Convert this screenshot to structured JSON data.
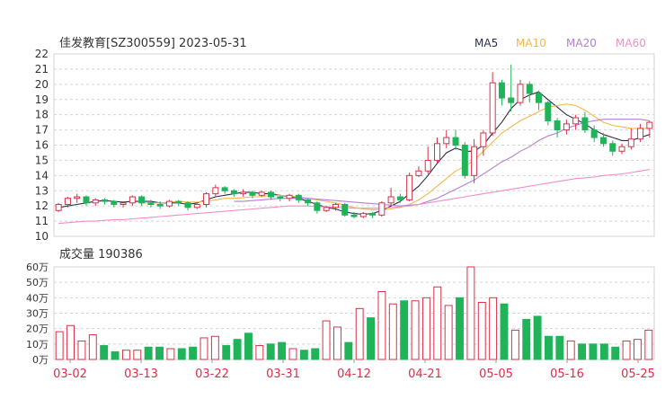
{
  "title": "佳发教育[SZ300559] 2023-05-31",
  "legend": [
    {
      "label": "MA5",
      "color": "#2b2d4f"
    },
    {
      "label": "MA10",
      "color": "#f2b84b"
    },
    {
      "label": "MA20",
      "color": "#b07fd6"
    },
    {
      "label": "MA60",
      "color": "#f08fc5"
    }
  ],
  "volume_label": "成交量 190386",
  "colors": {
    "up": "#d9304a",
    "down": "#21b35a",
    "grid": "#d4d4d4",
    "axis_text": "#333333",
    "date_text": "#d9304a"
  },
  "chart_data": [
    {
      "type": "candlestick",
      "title": "佳发教育[SZ300559] 2023-05-31",
      "ylim": [
        10,
        22
      ],
      "yticks": [
        10,
        11,
        12,
        13,
        14,
        15,
        16,
        17,
        18,
        19,
        20,
        21,
        22
      ],
      "dates": [
        "03-02",
        "03-13",
        "03-22",
        "03-31",
        "04-12",
        "04-21",
        "05-05",
        "05-16",
        "05-25"
      ],
      "candles": [
        [
          11.7,
          12.1,
          11.6,
          12.2
        ],
        [
          12.1,
          12.5,
          11.9,
          12.6
        ],
        [
          12.5,
          12.6,
          12.2,
          12.8
        ],
        [
          12.6,
          12.2,
          12.0,
          12.7
        ],
        [
          12.2,
          12.4,
          12.0,
          12.5
        ],
        [
          12.4,
          12.3,
          12.1,
          12.5
        ],
        [
          12.3,
          12.1,
          11.9,
          12.4
        ],
        [
          12.1,
          12.2,
          11.9,
          12.3
        ],
        [
          12.2,
          12.6,
          12.0,
          12.7
        ],
        [
          12.6,
          12.2,
          12.0,
          12.7
        ],
        [
          12.2,
          12.1,
          11.9,
          12.4
        ],
        [
          12.1,
          12.0,
          11.8,
          12.3
        ],
        [
          12.0,
          12.3,
          11.9,
          12.4
        ],
        [
          12.3,
          12.2,
          12.0,
          12.4
        ],
        [
          12.2,
          11.9,
          11.7,
          12.3
        ],
        [
          11.9,
          12.1,
          11.8,
          12.2
        ],
        [
          12.1,
          12.8,
          11.9,
          12.9
        ],
        [
          12.8,
          13.2,
          12.6,
          13.4
        ],
        [
          13.2,
          13.0,
          12.8,
          13.3
        ],
        [
          13.0,
          12.8,
          12.6,
          13.1
        ],
        [
          12.8,
          12.9,
          12.6,
          13.1
        ],
        [
          12.9,
          12.7,
          12.5,
          13.0
        ],
        [
          12.7,
          12.9,
          12.6,
          13.0
        ],
        [
          12.9,
          12.6,
          12.4,
          13.0
        ],
        [
          12.6,
          12.5,
          12.3,
          12.7
        ],
        [
          12.5,
          12.7,
          12.3,
          12.8
        ],
        [
          12.7,
          12.4,
          12.2,
          12.8
        ],
        [
          12.4,
          12.2,
          12.0,
          12.5
        ],
        [
          12.2,
          11.7,
          11.5,
          12.3
        ],
        [
          11.7,
          11.9,
          11.6,
          12.0
        ],
        [
          11.9,
          12.1,
          11.7,
          12.2
        ],
        [
          12.1,
          11.4,
          11.3,
          12.2
        ],
        [
          11.4,
          11.3,
          11.2,
          11.6
        ],
        [
          11.3,
          11.5,
          11.2,
          11.6
        ],
        [
          11.5,
          11.4,
          11.2,
          11.6
        ],
        [
          11.4,
          12.2,
          11.3,
          12.3
        ],
        [
          12.2,
          12.6,
          12.0,
          13.2
        ],
        [
          12.6,
          12.4,
          12.2,
          12.8
        ],
        [
          12.4,
          14.0,
          12.3,
          14.2
        ],
        [
          14.0,
          14.3,
          13.9,
          14.6
        ],
        [
          14.3,
          15.0,
          14.1,
          15.9
        ],
        [
          15.0,
          16.1,
          14.8,
          16.5
        ],
        [
          16.1,
          16.5,
          15.8,
          17.0
        ],
        [
          16.5,
          16.0,
          15.7,
          17.0
        ],
        [
          16.0,
          14.0,
          13.8,
          16.2
        ],
        [
          14.0,
          15.9,
          13.5,
          16.4
        ],
        [
          15.9,
          16.8,
          15.3,
          17.0
        ],
        [
          16.8,
          20.1,
          16.6,
          20.8
        ],
        [
          20.1,
          19.1,
          18.6,
          20.3
        ],
        [
          19.1,
          18.8,
          18.2,
          21.3
        ],
        [
          18.8,
          20.0,
          18.6,
          20.3
        ],
        [
          20.0,
          19.4,
          18.8,
          20.2
        ],
        [
          19.4,
          18.8,
          18.3,
          19.6
        ],
        [
          18.8,
          17.6,
          17.3,
          18.9
        ],
        [
          17.6,
          17.0,
          16.5,
          17.8
        ],
        [
          17.0,
          17.4,
          16.7,
          17.7
        ],
        [
          17.4,
          17.8,
          17.0,
          18.0
        ],
        [
          17.8,
          17.0,
          16.8,
          18.2
        ],
        [
          17.0,
          16.5,
          16.2,
          17.3
        ],
        [
          16.5,
          16.1,
          15.9,
          16.8
        ],
        [
          16.1,
          15.6,
          15.3,
          16.3
        ],
        [
          15.6,
          15.9,
          15.4,
          16.1
        ],
        [
          15.9,
          16.4,
          15.7,
          17.1
        ],
        [
          16.4,
          17.1,
          16.2,
          17.4
        ],
        [
          17.1,
          17.5,
          16.5,
          17.6
        ]
      ],
      "volumes": [
        18,
        22,
        12,
        16,
        9,
        5,
        6,
        6,
        8,
        8,
        7,
        7,
        8,
        14,
        15,
        9,
        13,
        17,
        9,
        10,
        11,
        7,
        6,
        7,
        25,
        21,
        11,
        33,
        27,
        44,
        36,
        38,
        38,
        40,
        47,
        35,
        40,
        60,
        37,
        40,
        36,
        19,
        26,
        28,
        15,
        15,
        12,
        10,
        10,
        10,
        8,
        12,
        13,
        19
      ],
      "vol_ylim": [
        0,
        60
      ],
      "vol_ticks": [
        "0万",
        "10万",
        "20万",
        "30万",
        "40万",
        "50万",
        "60万"
      ],
      "ma_lines": [
        {
          "name": "MA5",
          "values": [
            11.9,
            12.0,
            12.1,
            12.2,
            12.3,
            12.35,
            12.3,
            12.25,
            12.3,
            12.3,
            12.3,
            12.2,
            12.2,
            12.2,
            12.1,
            12.2,
            12.4,
            12.6,
            12.7,
            12.8,
            12.9,
            12.9,
            12.8,
            12.8,
            12.7,
            12.6,
            12.5,
            12.3,
            12.1,
            11.9,
            11.8,
            11.6,
            11.5,
            11.45,
            11.5,
            11.7,
            12.0,
            12.3,
            12.8,
            13.3,
            14.0,
            14.8,
            15.5,
            15.8,
            15.6,
            15.6,
            16.0,
            16.8,
            17.5,
            18.4,
            19.0,
            19.3,
            19.5,
            19.0,
            18.5,
            18.0,
            17.7,
            17.4,
            17.0,
            16.7,
            16.5,
            16.3,
            16.3,
            16.5,
            16.7
          ]
        },
        {
          "name": "MA10",
          "values": [
            null,
            null,
            null,
            null,
            null,
            null,
            null,
            null,
            null,
            12.2,
            12.2,
            12.2,
            12.25,
            12.3,
            12.25,
            12.25,
            12.3,
            12.4,
            12.5,
            12.5,
            12.55,
            12.6,
            12.6,
            12.7,
            12.7,
            12.65,
            12.6,
            12.5,
            12.4,
            12.3,
            12.2,
            12.05,
            11.9,
            11.8,
            11.75,
            11.75,
            11.8,
            11.9,
            12.1,
            12.4,
            12.8,
            13.3,
            13.8,
            14.3,
            14.6,
            15.0,
            15.6,
            16.2,
            16.8,
            17.2,
            17.6,
            17.9,
            18.2,
            18.5,
            18.6,
            18.7,
            18.6,
            18.3,
            17.9,
            17.5,
            17.3,
            17.2,
            17.1,
            17.1,
            17.1
          ]
        },
        {
          "name": "MA20",
          "values": [
            null,
            null,
            null,
            null,
            null,
            null,
            null,
            null,
            null,
            null,
            null,
            null,
            null,
            null,
            null,
            null,
            null,
            null,
            null,
            12.3,
            12.3,
            12.35,
            12.4,
            12.45,
            12.5,
            12.5,
            12.5,
            12.5,
            12.45,
            12.4,
            12.35,
            12.3,
            12.25,
            12.2,
            12.15,
            12.1,
            12.05,
            12.0,
            12.05,
            12.1,
            12.3,
            12.5,
            12.8,
            13.1,
            13.4,
            13.7,
            14.1,
            14.5,
            14.9,
            15.2,
            15.6,
            15.9,
            16.3,
            16.6,
            16.8,
            17.1,
            17.3,
            17.5,
            17.6,
            17.7,
            17.7,
            17.7,
            17.7,
            17.7,
            17.6
          ]
        },
        {
          "name": "MA60",
          "values": [
            10.85,
            10.9,
            10.95,
            11.0,
            11.0,
            11.05,
            11.1,
            11.1,
            11.15,
            11.2,
            11.25,
            11.3,
            11.35,
            11.4,
            11.45,
            11.5,
            11.55,
            11.6,
            11.65,
            11.7,
            11.75,
            11.8,
            11.85,
            11.9,
            11.95,
            12.0,
            12.0,
            12.0,
            11.95,
            11.95,
            11.9,
            11.9,
            11.85,
            11.85,
            11.85,
            11.85,
            11.9,
            11.95,
            12.0,
            12.1,
            12.2,
            12.3,
            12.4,
            12.5,
            12.6,
            12.7,
            12.8,
            12.9,
            13.0,
            13.1,
            13.2,
            13.3,
            13.4,
            13.5,
            13.6,
            13.7,
            13.8,
            13.85,
            13.9,
            14.0,
            14.05,
            14.1,
            14.2,
            14.3,
            14.4
          ]
        }
      ]
    }
  ]
}
